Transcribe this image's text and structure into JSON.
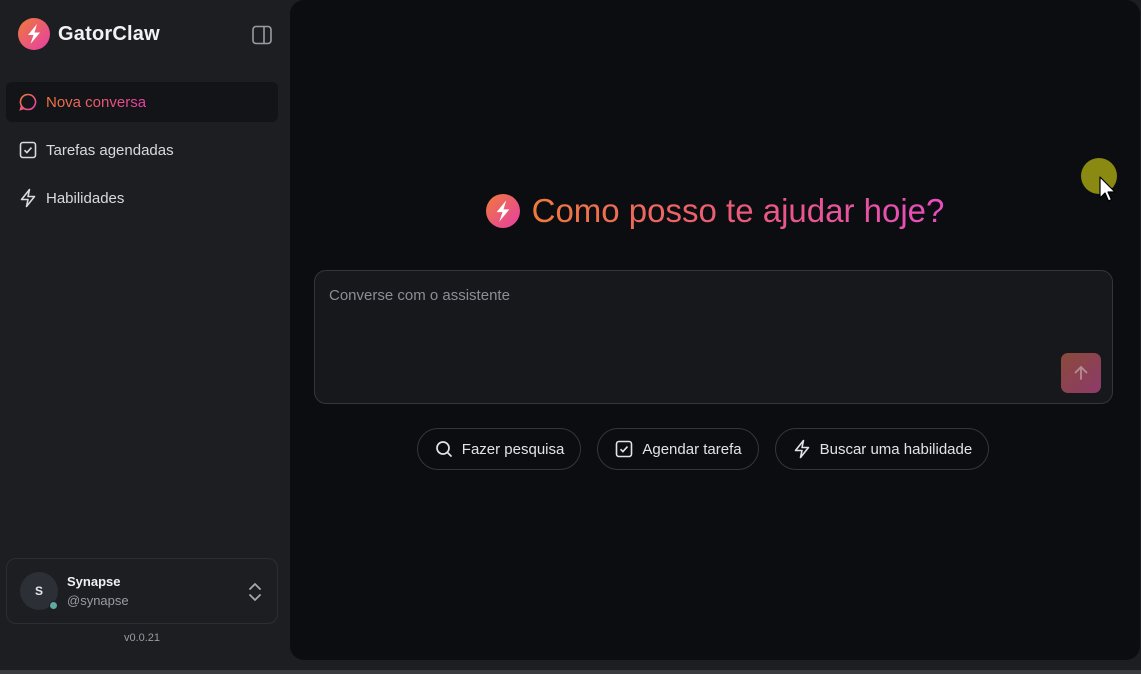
{
  "app": {
    "name": "GatorClaw",
    "version": "v0.0.21",
    "accent_start": "#ef7a3c",
    "accent_end": "#e63ea6"
  },
  "sidebar": {
    "toggle_icon": "sidebar-panel-icon",
    "items": [
      {
        "label": "Nova conversa",
        "icon": "chat-plus-icon",
        "active": true
      },
      {
        "label": "Tarefas agendadas",
        "icon": "checkbox-icon",
        "active": false
      },
      {
        "label": "Habilidades",
        "icon": "lightning-icon",
        "active": false
      }
    ]
  },
  "user": {
    "initial": "S",
    "name": "Synapse",
    "handle": "@synapse",
    "status_color": "#5fa8a0"
  },
  "main": {
    "title": "Como posso te ajudar hoje?",
    "composer": {
      "placeholder": "Converse com o assistente",
      "value": "",
      "send_icon": "arrow-up-icon"
    },
    "suggestions": [
      {
        "label": "Fazer pesquisa",
        "icon": "search-icon"
      },
      {
        "label": "Agendar tarefa",
        "icon": "checkbox-icon"
      },
      {
        "label": "Buscar uma habilidade",
        "icon": "lightning-icon"
      }
    ]
  }
}
